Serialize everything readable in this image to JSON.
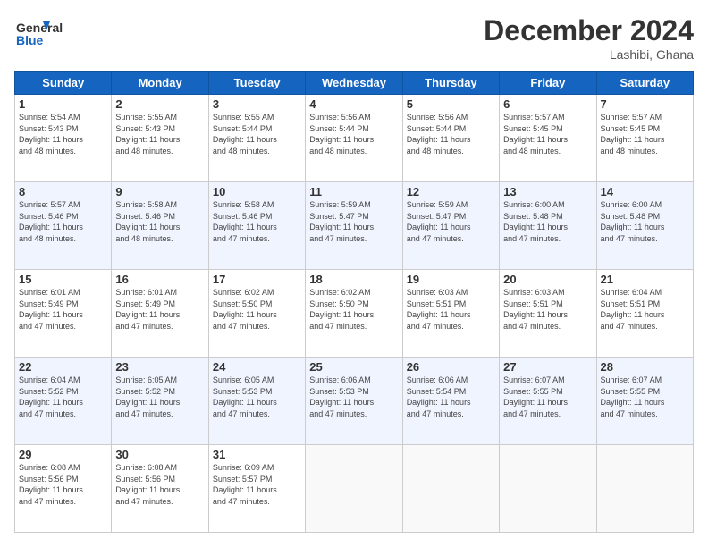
{
  "logo": {
    "line1": "General",
    "line2": "Blue"
  },
  "title": "December 2024",
  "location": "Lashibi, Ghana",
  "weekdays": [
    "Sunday",
    "Monday",
    "Tuesday",
    "Wednesday",
    "Thursday",
    "Friday",
    "Saturday"
  ],
  "weeks": [
    [
      {
        "day": "1",
        "info": "Sunrise: 5:54 AM\nSunset: 5:43 PM\nDaylight: 11 hours\nand 48 minutes."
      },
      {
        "day": "2",
        "info": "Sunrise: 5:55 AM\nSunset: 5:43 PM\nDaylight: 11 hours\nand 48 minutes."
      },
      {
        "day": "3",
        "info": "Sunrise: 5:55 AM\nSunset: 5:44 PM\nDaylight: 11 hours\nand 48 minutes."
      },
      {
        "day": "4",
        "info": "Sunrise: 5:56 AM\nSunset: 5:44 PM\nDaylight: 11 hours\nand 48 minutes."
      },
      {
        "day": "5",
        "info": "Sunrise: 5:56 AM\nSunset: 5:44 PM\nDaylight: 11 hours\nand 48 minutes."
      },
      {
        "day": "6",
        "info": "Sunrise: 5:57 AM\nSunset: 5:45 PM\nDaylight: 11 hours\nand 48 minutes."
      },
      {
        "day": "7",
        "info": "Sunrise: 5:57 AM\nSunset: 5:45 PM\nDaylight: 11 hours\nand 48 minutes."
      }
    ],
    [
      {
        "day": "8",
        "info": "Sunrise: 5:57 AM\nSunset: 5:46 PM\nDaylight: 11 hours\nand 48 minutes."
      },
      {
        "day": "9",
        "info": "Sunrise: 5:58 AM\nSunset: 5:46 PM\nDaylight: 11 hours\nand 48 minutes."
      },
      {
        "day": "10",
        "info": "Sunrise: 5:58 AM\nSunset: 5:46 PM\nDaylight: 11 hours\nand 47 minutes."
      },
      {
        "day": "11",
        "info": "Sunrise: 5:59 AM\nSunset: 5:47 PM\nDaylight: 11 hours\nand 47 minutes."
      },
      {
        "day": "12",
        "info": "Sunrise: 5:59 AM\nSunset: 5:47 PM\nDaylight: 11 hours\nand 47 minutes."
      },
      {
        "day": "13",
        "info": "Sunrise: 6:00 AM\nSunset: 5:48 PM\nDaylight: 11 hours\nand 47 minutes."
      },
      {
        "day": "14",
        "info": "Sunrise: 6:00 AM\nSunset: 5:48 PM\nDaylight: 11 hours\nand 47 minutes."
      }
    ],
    [
      {
        "day": "15",
        "info": "Sunrise: 6:01 AM\nSunset: 5:49 PM\nDaylight: 11 hours\nand 47 minutes."
      },
      {
        "day": "16",
        "info": "Sunrise: 6:01 AM\nSunset: 5:49 PM\nDaylight: 11 hours\nand 47 minutes."
      },
      {
        "day": "17",
        "info": "Sunrise: 6:02 AM\nSunset: 5:50 PM\nDaylight: 11 hours\nand 47 minutes."
      },
      {
        "day": "18",
        "info": "Sunrise: 6:02 AM\nSunset: 5:50 PM\nDaylight: 11 hours\nand 47 minutes."
      },
      {
        "day": "19",
        "info": "Sunrise: 6:03 AM\nSunset: 5:51 PM\nDaylight: 11 hours\nand 47 minutes."
      },
      {
        "day": "20",
        "info": "Sunrise: 6:03 AM\nSunset: 5:51 PM\nDaylight: 11 hours\nand 47 minutes."
      },
      {
        "day": "21",
        "info": "Sunrise: 6:04 AM\nSunset: 5:51 PM\nDaylight: 11 hours\nand 47 minutes."
      }
    ],
    [
      {
        "day": "22",
        "info": "Sunrise: 6:04 AM\nSunset: 5:52 PM\nDaylight: 11 hours\nand 47 minutes."
      },
      {
        "day": "23",
        "info": "Sunrise: 6:05 AM\nSunset: 5:52 PM\nDaylight: 11 hours\nand 47 minutes."
      },
      {
        "day": "24",
        "info": "Sunrise: 6:05 AM\nSunset: 5:53 PM\nDaylight: 11 hours\nand 47 minutes."
      },
      {
        "day": "25",
        "info": "Sunrise: 6:06 AM\nSunset: 5:53 PM\nDaylight: 11 hours\nand 47 minutes."
      },
      {
        "day": "26",
        "info": "Sunrise: 6:06 AM\nSunset: 5:54 PM\nDaylight: 11 hours\nand 47 minutes."
      },
      {
        "day": "27",
        "info": "Sunrise: 6:07 AM\nSunset: 5:55 PM\nDaylight: 11 hours\nand 47 minutes."
      },
      {
        "day": "28",
        "info": "Sunrise: 6:07 AM\nSunset: 5:55 PM\nDaylight: 11 hours\nand 47 minutes."
      }
    ],
    [
      {
        "day": "29",
        "info": "Sunrise: 6:08 AM\nSunset: 5:56 PM\nDaylight: 11 hours\nand 47 minutes."
      },
      {
        "day": "30",
        "info": "Sunrise: 6:08 AM\nSunset: 5:56 PM\nDaylight: 11 hours\nand 47 minutes."
      },
      {
        "day": "31",
        "info": "Sunrise: 6:09 AM\nSunset: 5:57 PM\nDaylight: 11 hours\nand 47 minutes."
      },
      {
        "day": "",
        "info": ""
      },
      {
        "day": "",
        "info": ""
      },
      {
        "day": "",
        "info": ""
      },
      {
        "day": "",
        "info": ""
      }
    ]
  ]
}
